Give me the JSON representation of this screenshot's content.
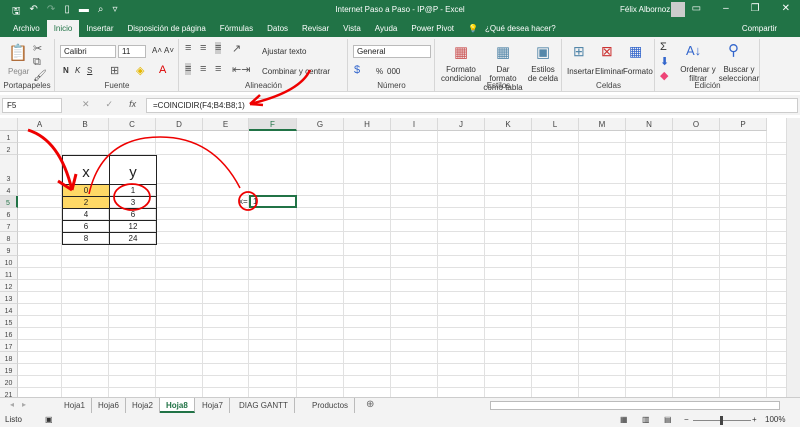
{
  "title": "Internet Paso a Paso - IP@P  -  Excel",
  "user": "Félix Albornoz",
  "quick_access": [
    "save-icon",
    "undo-icon",
    "redo-icon",
    "new-icon",
    "open-icon",
    "print-preview-icon",
    "customize-icon"
  ],
  "tabs": [
    "Archivo",
    "Inicio",
    "Insertar",
    "Disposición de página",
    "Fórmulas",
    "Datos",
    "Revisar",
    "Vista",
    "Ayuda",
    "Power Pivot"
  ],
  "active_tab": "Inicio",
  "tell_me": "¿Qué desea hacer?",
  "share": "Compartir",
  "ribbon": {
    "clipboard": {
      "paste": "Pegar",
      "label": "Portapapeles"
    },
    "font": {
      "name": "Calibri",
      "size": "11",
      "bold": "N",
      "italic": "K",
      "underline": "S",
      "label": "Fuente"
    },
    "alignment": {
      "wrap": "Ajustar texto",
      "merge": "Combinar y centrar",
      "label": "Alineación"
    },
    "number": {
      "format": "General",
      "percent": "%",
      "thousands": "000",
      "label": "Número"
    },
    "styles": {
      "conditional": "Formato condicional",
      "table": "Dar formato como tabla",
      "cell": "Estilos de celda",
      "label": "Estilos"
    },
    "cells": {
      "insert": "Insertar",
      "delete": "Eliminar",
      "format": "Formato",
      "label": "Celdas"
    },
    "editing": {
      "sort": "Ordenar y filtrar",
      "find": "Buscar y seleccionar",
      "sum": "Σ",
      "label": "Edición"
    }
  },
  "formula_bar": {
    "name_box": "F5",
    "formula": "=COINCIDIR(F4;B4:B8;1)",
    "fx": "fx"
  },
  "columns": [
    "A",
    "B",
    "C",
    "D",
    "E",
    "F",
    "G",
    "H",
    "I",
    "J",
    "K",
    "L",
    "M",
    "N",
    "O",
    "P"
  ],
  "rows": [
    "1",
    "2",
    "3",
    "4",
    "5",
    "6",
    "7",
    "8",
    "9",
    "10",
    "11",
    "12",
    "13",
    "14",
    "15",
    "16",
    "17",
    "18",
    "19",
    "20",
    "21"
  ],
  "table": {
    "header_x": "x",
    "header_y": "y",
    "x": [
      "0",
      "2",
      "4",
      "6",
      "8"
    ],
    "y": [
      "1",
      "3",
      "6",
      "12",
      "24"
    ]
  },
  "lookup": {
    "label": "x=",
    "value": "1"
  },
  "highlight_color": "#ffd966",
  "sheets": [
    "Hoja1",
    "Hoja6",
    "Hoja2",
    "Hoja8",
    "Hoja7",
    "DIAG GANTT",
    "Productos"
  ],
  "active_sheet": "Hoja8",
  "status": {
    "ready": "Listo",
    "zoom": "100%"
  }
}
